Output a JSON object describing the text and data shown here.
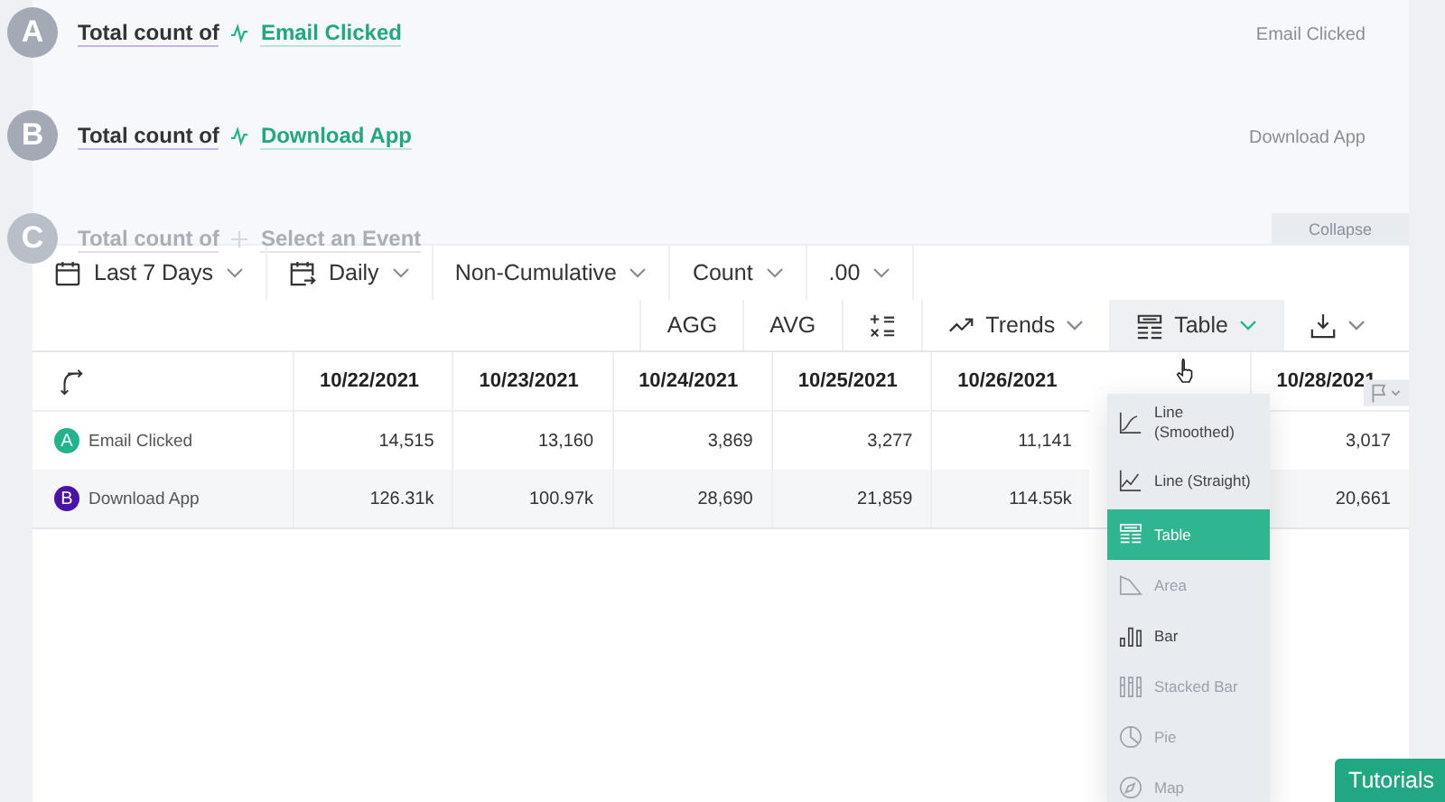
{
  "queries": [
    {
      "letter": "A",
      "prefix": "Total count of",
      "event": "Email Clicked",
      "legend": "Email Clicked",
      "enabled": true
    },
    {
      "letter": "B",
      "prefix": "Total count of",
      "event": "Download App",
      "legend": "Download App",
      "enabled": true
    },
    {
      "letter": "C",
      "prefix": "Total count of",
      "event": "Select an Event",
      "enabled": false
    }
  ],
  "collapse": "Collapse",
  "toolbar": [
    {
      "kind": "date",
      "label": "Last 7 Days"
    },
    {
      "kind": "interval",
      "label": "Daily"
    },
    {
      "kind": "select",
      "label": "Non-Cumulative"
    },
    {
      "kind": "select",
      "label": "Count"
    },
    {
      "kind": "select",
      "label": ".00"
    }
  ],
  "view_bar": [
    {
      "kind": "text",
      "label": "AGG"
    },
    {
      "kind": "text",
      "label": "AVG"
    },
    {
      "kind": "formula"
    },
    {
      "kind": "trends",
      "label": "Trends",
      "open": false
    },
    {
      "kind": "table",
      "label": "Table",
      "open": true
    },
    {
      "kind": "download",
      "open": false
    }
  ],
  "table": {
    "columns": [
      {
        "label": "10/22/2021"
      },
      {
        "label": "10/23/2021"
      },
      {
        "label": "10/24/2021"
      },
      {
        "label": "10/25/2021"
      },
      {
        "label": "10/26/2021"
      },
      {
        "covered": true
      },
      {
        "label": "10/28/2021"
      }
    ],
    "rows": [
      {
        "letter": "A",
        "color": "#21b48a",
        "name": "Email Clicked",
        "values": [
          "14,515",
          "13,160",
          "3,869",
          "3,277",
          "11,141",
          "3,017"
        ]
      },
      {
        "letter": "B",
        "color": "#4b12a6",
        "name": "Download App",
        "values": [
          "126.31k",
          "100.97k",
          "28,690",
          "21,859",
          "114.55k",
          "20,661"
        ]
      }
    ]
  },
  "chart_menu": [
    {
      "kind": "line-smooth",
      "label": "Line (Smoothed)",
      "selected": false,
      "disabled": false
    },
    {
      "kind": "line-straight",
      "label": "Line (Straight)",
      "selected": false,
      "disabled": false
    },
    {
      "kind": "table",
      "label": "Table",
      "selected": true,
      "disabled": false
    },
    {
      "kind": "area",
      "label": "Area",
      "selected": false,
      "disabled": true
    },
    {
      "kind": "bar",
      "label": "Bar",
      "selected": false,
      "disabled": false
    },
    {
      "kind": "stacked",
      "label": "Stacked Bar",
      "selected": false,
      "disabled": true
    },
    {
      "kind": "pie",
      "label": "Pie",
      "selected": false,
      "disabled": true
    },
    {
      "kind": "map",
      "label": "Map",
      "selected": false,
      "disabled": true
    }
  ],
  "tutorials": "Tutorials"
}
